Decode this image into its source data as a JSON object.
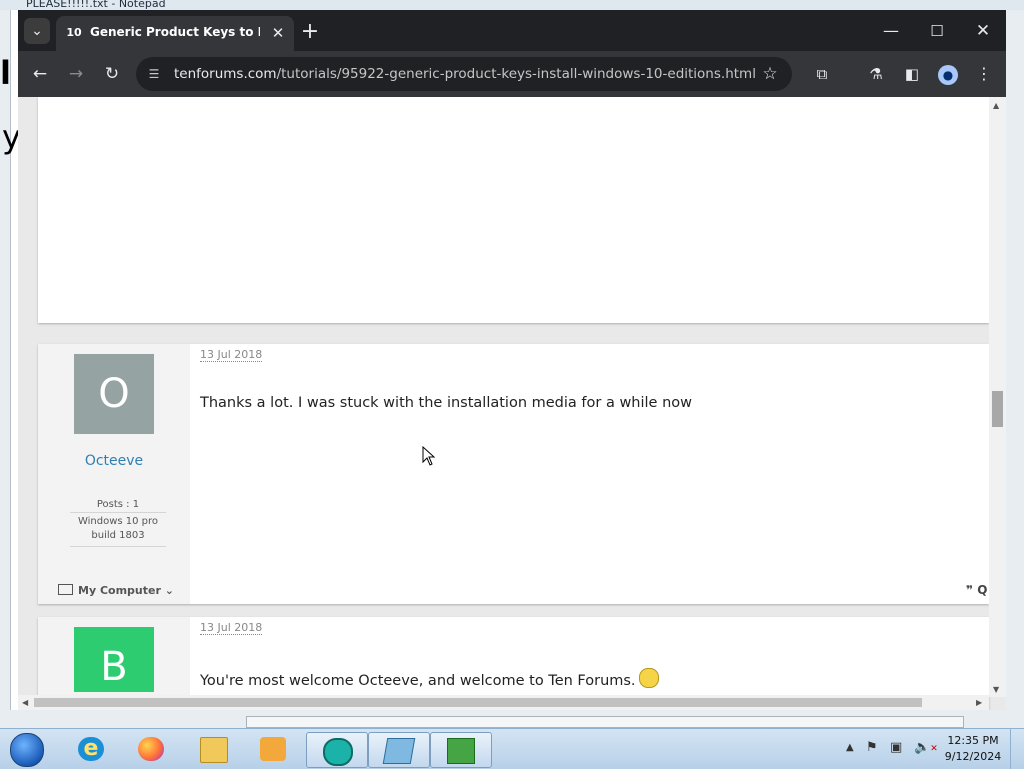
{
  "background_window": {
    "title": "PLEASE!!!!!.txt - Notepad",
    "big_text_1": "l",
    "big_text_2": "y"
  },
  "browser": {
    "tab": {
      "favicon_text": "10",
      "title": "Generic Product Keys to Install",
      "close": "✕"
    },
    "new_tab": "+",
    "window_controls": {
      "minimize": "—",
      "maximize": "☐",
      "close": "✕"
    },
    "toolbar": {
      "back": "←",
      "forward": "→",
      "reload": "↻",
      "url_domain": "tenforums.com",
      "url_path": "/tutorials/95922-generic-product-keys-install-windows-10-editions.html",
      "bookmark": "☆",
      "extensions": "⧉",
      "labs": "⚗",
      "side_panel": "◧",
      "profile": "●",
      "menu": "⋮"
    }
  },
  "posts": [
    {
      "avatar_letter": "O",
      "avatar_color": "#96a3a3",
      "username": "Octeeve",
      "posts_count": "Posts : 1",
      "os": "Windows 10 pro build 1803",
      "my_computer": "My Computer",
      "date": "13 Jul 2018",
      "text": "Thanks a lot. I was stuck with the installation media for a while now",
      "quote": "❞ Q"
    },
    {
      "avatar_letter": "B",
      "avatar_color": "#2ecc71",
      "date": "13 Jul 2018",
      "text": "You're most welcome Octeeve, and welcome to Ten Forums."
    }
  ],
  "taskbar": {
    "clock_time": "12:35 PM",
    "clock_date": "9/12/2024",
    "tray_up": "▲",
    "tray_flag": "⚑",
    "tray_network": "▣",
    "tray_volume": "🔈",
    "tray_volume_muted": "✕",
    "ie_glyph": "e"
  }
}
